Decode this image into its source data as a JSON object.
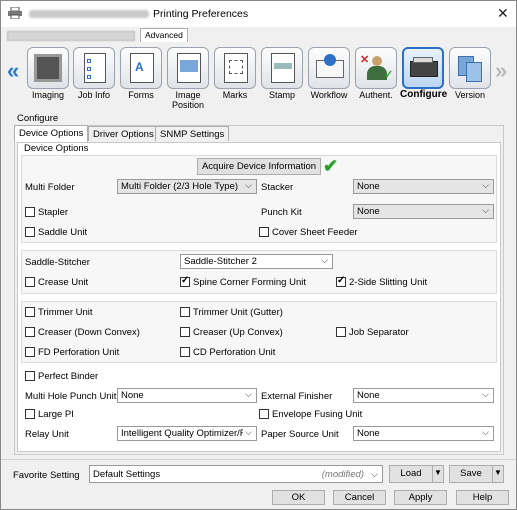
{
  "window": {
    "title": "Printing Preferences"
  },
  "tabs": {
    "advanced": "Advanced"
  },
  "ribbon": [
    {
      "label": "Imaging",
      "icon": "imaging-icon"
    },
    {
      "label": "Job Info",
      "icon": "job-info-icon"
    },
    {
      "label": "Forms",
      "icon": "forms-icon"
    },
    {
      "label": "Image\nPosition",
      "icon": "image-position-icon"
    },
    {
      "label": "Marks",
      "icon": "marks-icon"
    },
    {
      "label": "Stamp",
      "icon": "stamp-icon"
    },
    {
      "label": "Workflow",
      "icon": "workflow-icon"
    },
    {
      "label": "Authent.",
      "icon": "authentication-icon"
    },
    {
      "label": "Configure",
      "icon": "configure-icon",
      "selected": true
    },
    {
      "label": "Version",
      "icon": "version-icon"
    }
  ],
  "configure": {
    "section_title": "Configure",
    "sub_tabs": [
      "Device Options",
      "Driver Options",
      "SNMP Settings"
    ],
    "device_options_title": "Device Options",
    "acquire_button": "Acquire Device Information",
    "multi_folder": {
      "label": "Multi Folder",
      "value": "Multi Folder (2/3 Hole Type)"
    },
    "stacker": {
      "label": "Stacker",
      "value": "None"
    },
    "stapler": {
      "label": "Stapler",
      "checked": false
    },
    "punch_kit": {
      "label": "Punch Kit",
      "value": "None"
    },
    "saddle_unit": {
      "label": "Saddle Unit",
      "checked": false
    },
    "cover_sheet_feeder": {
      "label": "Cover Sheet Feeder",
      "checked": false
    },
    "saddle_stitcher": {
      "label": "Saddle-Stitcher",
      "value": "Saddle-Stitcher 2"
    },
    "crease_unit": {
      "label": "Crease Unit",
      "checked": false
    },
    "spine_corner": {
      "label": "Spine Corner Forming Unit",
      "checked": true
    },
    "two_side_slitting": {
      "label": "2-Side Slitting Unit",
      "checked": true
    },
    "trimmer_unit": {
      "label": "Trimmer Unit",
      "checked": false
    },
    "trimmer_gutter": {
      "label": "Trimmer Unit (Gutter)",
      "checked": false
    },
    "creaser_down": {
      "label": "Creaser (Down Convex)",
      "checked": false
    },
    "creaser_up": {
      "label": "Creaser (Up Convex)",
      "checked": false
    },
    "job_separator": {
      "label": "Job Separator",
      "checked": false
    },
    "fd_perforation": {
      "label": "FD Perforation Unit",
      "checked": false
    },
    "cd_perforation": {
      "label": "CD Perforation Unit",
      "checked": false
    },
    "perfect_binder": {
      "label": "Perfect Binder",
      "checked": false
    },
    "multi_hole_punch": {
      "label": "Multi Hole Punch Unit",
      "value": "None"
    },
    "external_finisher": {
      "label": "External Finisher",
      "value": "None"
    },
    "large_pi": {
      "label": "Large PI",
      "checked": false
    },
    "envelope_fusing": {
      "label": "Envelope Fusing Unit",
      "checked": false
    },
    "relay_unit": {
      "label": "Relay Unit",
      "value": "Intelligent Quality Optimizer/R"
    },
    "paper_source_unit": {
      "label": "Paper Source Unit",
      "value": "None"
    }
  },
  "favorite": {
    "label": "Favorite Setting",
    "value": "Default Settings",
    "modified": "(modified)",
    "load": "Load",
    "save": "Save"
  },
  "buttons": {
    "ok": "OK",
    "cancel": "Cancel",
    "apply": "Apply",
    "help": "Help"
  }
}
